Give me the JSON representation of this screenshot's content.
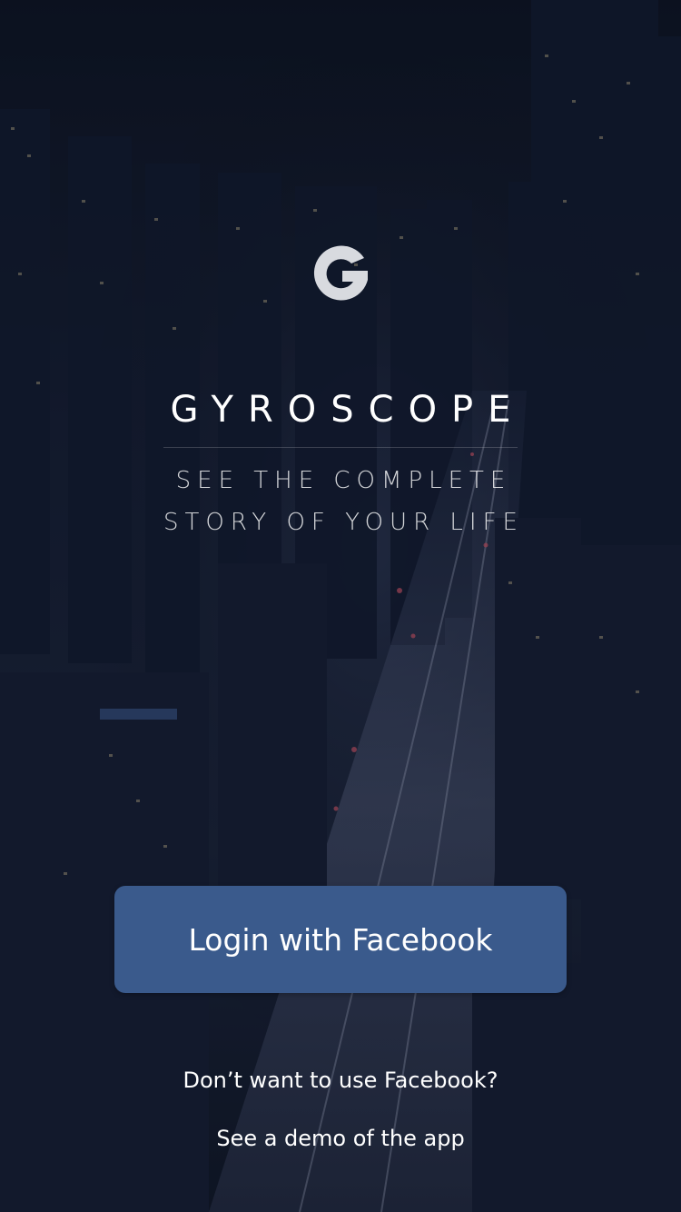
{
  "brand": {
    "logo_letter": "G",
    "title": "GYROSCOPE",
    "tagline_line1": "SEE THE COMPLETE",
    "tagline_line2": "STORY OF YOUR LIFE"
  },
  "actions": {
    "facebook_login_label": "Login with Facebook",
    "alternative_prompt": "Don’t want to use Facebook?",
    "demo_link_label": "See a demo of the app"
  },
  "colors": {
    "background": "#0d1322",
    "button": "#3a5a8c",
    "text": "#ffffff"
  },
  "background_image": "night-city-aerial"
}
